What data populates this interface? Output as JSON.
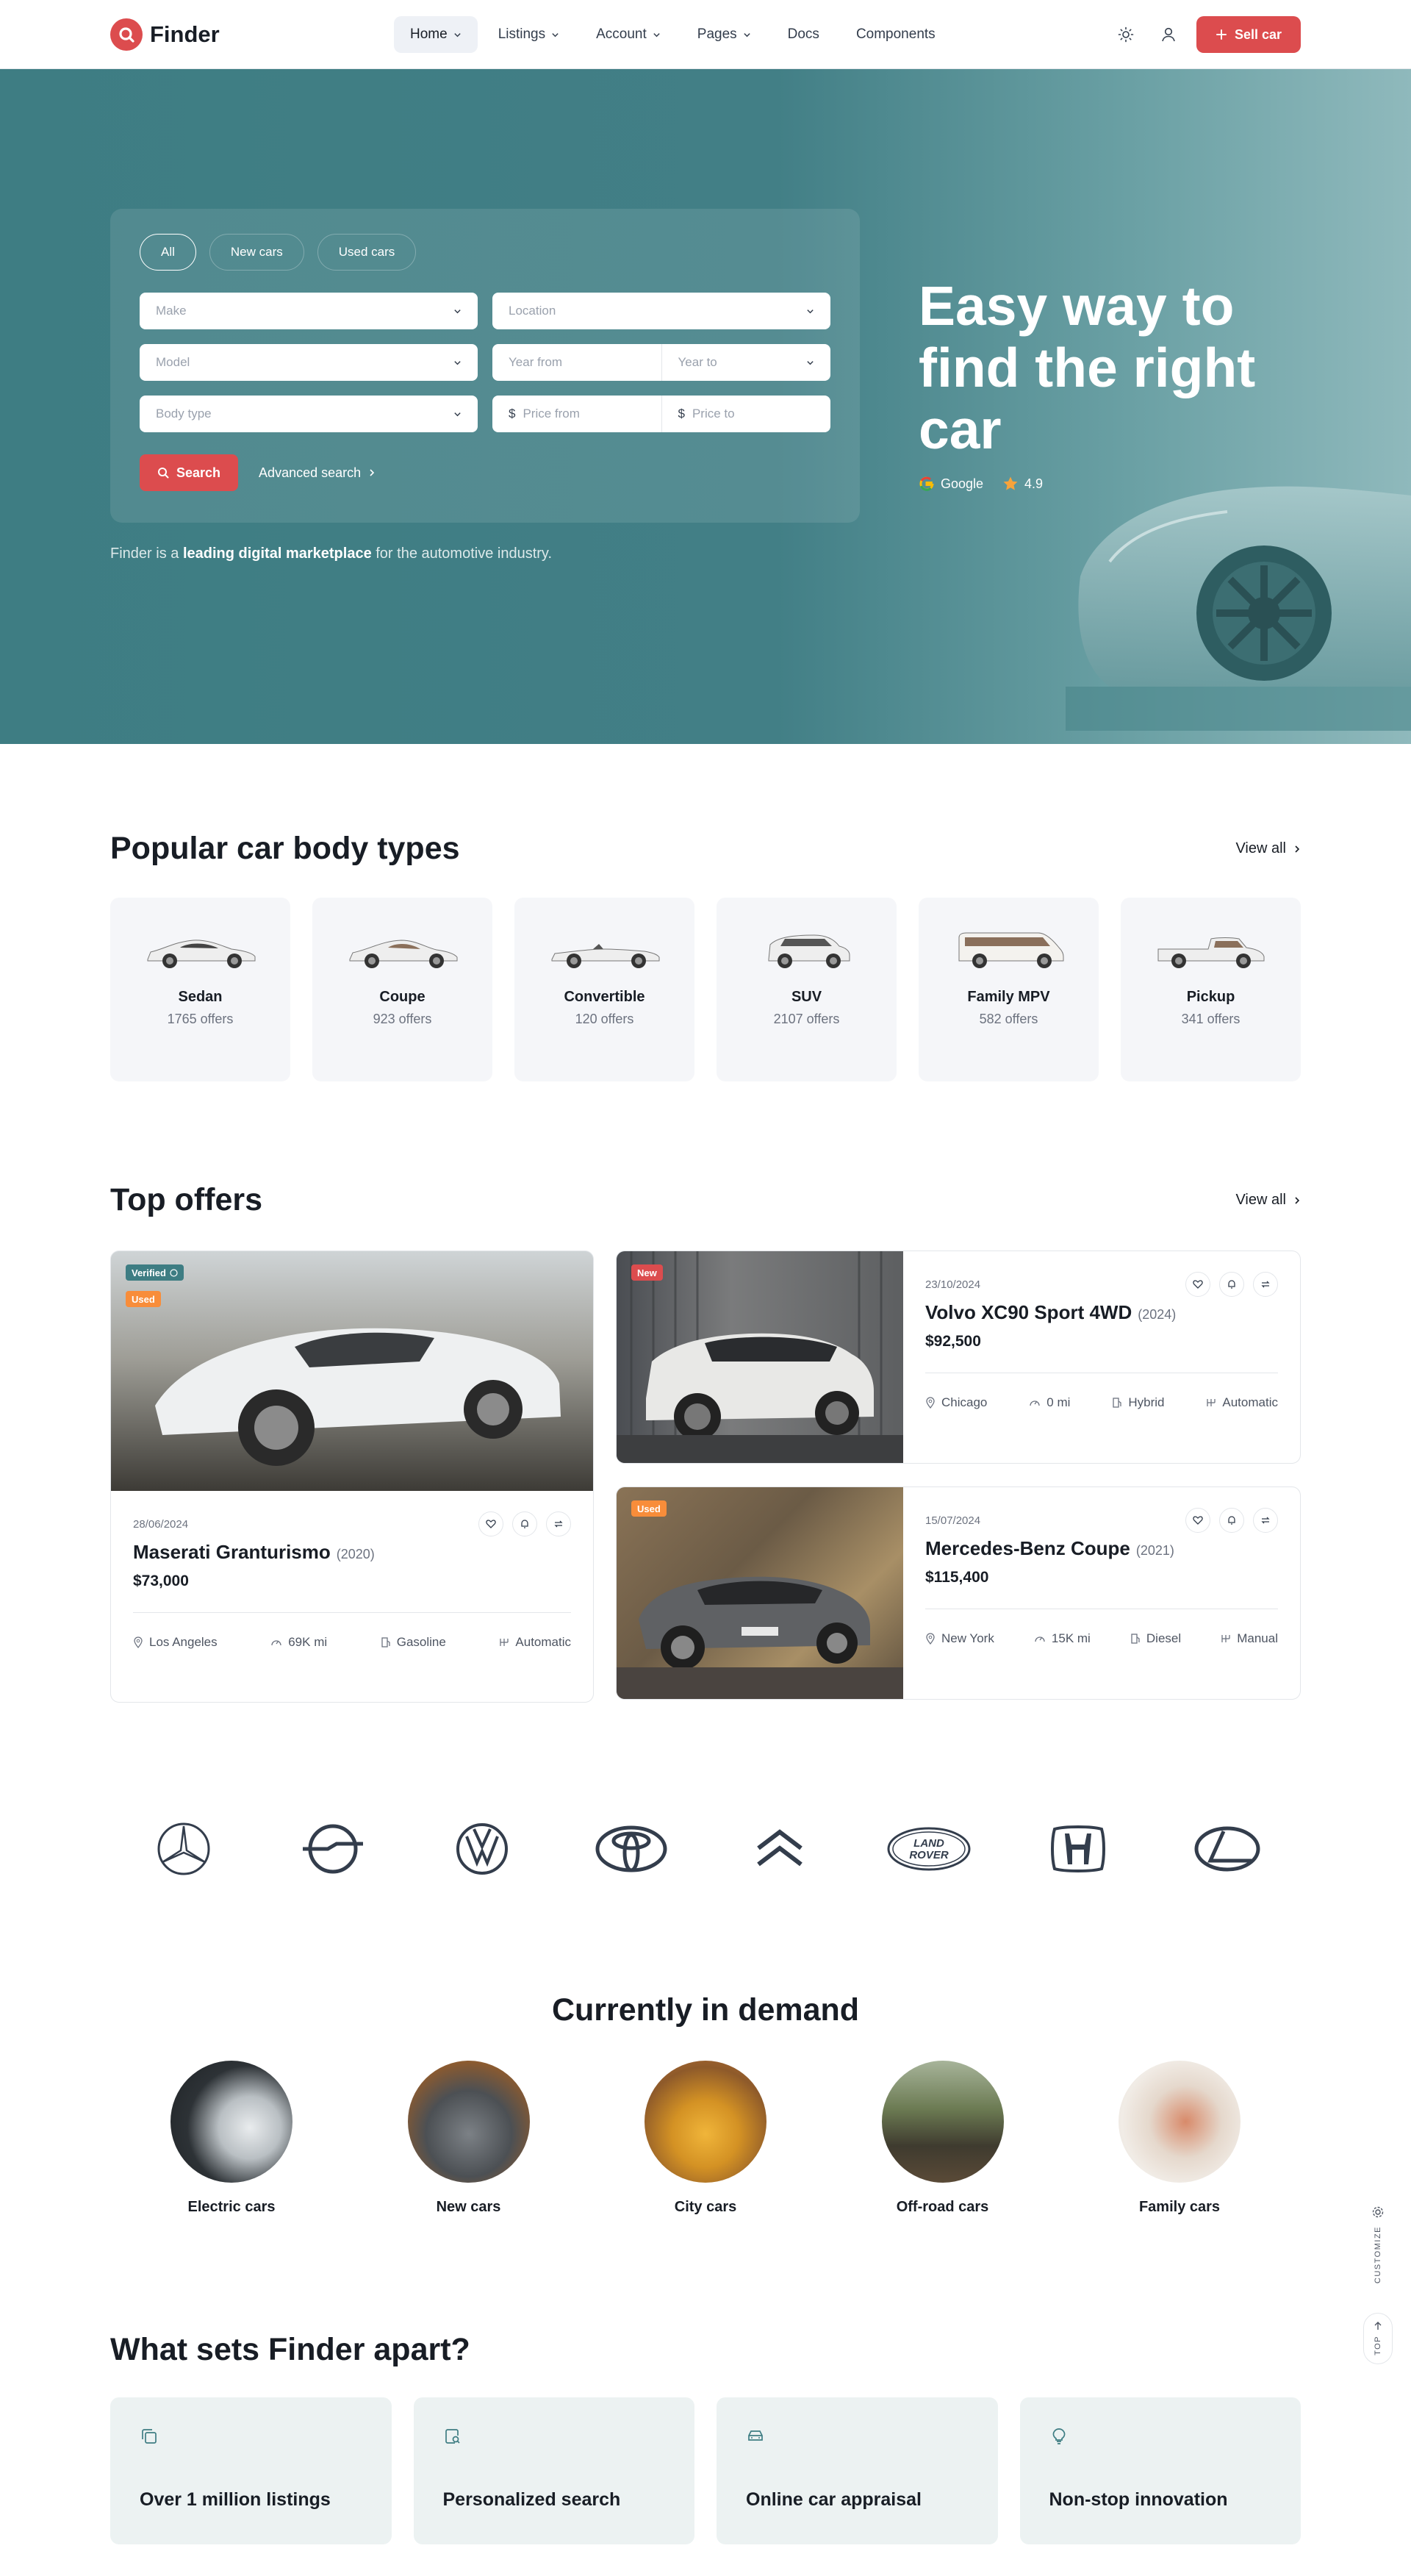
{
  "header": {
    "logo": "Finder",
    "nav": [
      {
        "label": "Home",
        "dropdown": true,
        "active": true
      },
      {
        "label": "Listings",
        "dropdown": true
      },
      {
        "label": "Account",
        "dropdown": true
      },
      {
        "label": "Pages",
        "dropdown": true
      },
      {
        "label": "Docs",
        "dropdown": false
      },
      {
        "label": "Components",
        "dropdown": false
      }
    ],
    "sell_button": "Sell car",
    "accent": "#dc4c4e"
  },
  "hero": {
    "tabs": [
      "All",
      "New cars",
      "Used cars"
    ],
    "fields": {
      "make": "Make",
      "location": "Location",
      "model": "Model",
      "year_from": "Year from",
      "year_to": "Year to",
      "body_type": "Body type",
      "price_from": "Price from",
      "price_to": "Price to"
    },
    "search_button": "Search",
    "advanced_link": "Advanced search",
    "note_prefix": "Finder is a",
    "note_bold": "leading digital marketplace",
    "note_suffix": "for the automotive industry.",
    "title": "Easy way to find the right car",
    "rating_google": "Google",
    "rating_value": "4.9"
  },
  "body_types": {
    "title": "Popular car body types",
    "view_all": "View all",
    "items": [
      {
        "name": "Sedan",
        "count": "1765 offers"
      },
      {
        "name": "Coupe",
        "count": "923 offers"
      },
      {
        "name": "Convertible",
        "count": "120 offers"
      },
      {
        "name": "SUV",
        "count": "2107 offers"
      },
      {
        "name": "Family MPV",
        "count": "582 offers"
      },
      {
        "name": "Pickup",
        "count": "341 offers"
      }
    ]
  },
  "offers": {
    "title": "Top offers",
    "view_all": "View all",
    "items": [
      {
        "date": "28/06/2024",
        "name": "Maserati Granturismo",
        "year": "(2020)",
        "price": "$73,000",
        "location": "Los Angeles",
        "mileage": "69K mi",
        "fuel": "Gasoline",
        "transmission": "Automatic",
        "badges": [
          "Verified",
          "Used"
        ]
      },
      {
        "date": "23/10/2024",
        "name": "Volvo XC90 Sport 4WD",
        "year": "(2024)",
        "price": "$92,500",
        "location": "Chicago",
        "mileage": "0 mi",
        "fuel": "Hybrid",
        "transmission": "Automatic",
        "badges": [
          "New"
        ]
      },
      {
        "date": "15/07/2024",
        "name": "Mercedes-Benz Coupe",
        "year": "(2021)",
        "price": "$115,400",
        "location": "New York",
        "mileage": "15K mi",
        "fuel": "Diesel",
        "transmission": "Manual",
        "badges": [
          "Used"
        ]
      }
    ]
  },
  "brands": [
    "mercedes-logo",
    "opel-logo",
    "volkswagen-logo",
    "toyota-logo",
    "citroen-logo",
    "land-rover-logo",
    "honda-logo",
    "lexus-logo"
  ],
  "brand_texts": {
    "land_rover_top": "LAND",
    "land_rover_bottom": "ROVER"
  },
  "demand": {
    "title": "Currently in demand",
    "items": [
      "Electric cars",
      "New cars",
      "City cars",
      "Off-road cars",
      "Family cars"
    ]
  },
  "apart": {
    "title": "What sets Finder apart?",
    "items": [
      "Over 1 million listings",
      "Personalized search",
      "Online car appraisal",
      "Non-stop innovation"
    ]
  },
  "side": {
    "customize": "CUSTOMIZE",
    "top": "TOP"
  }
}
